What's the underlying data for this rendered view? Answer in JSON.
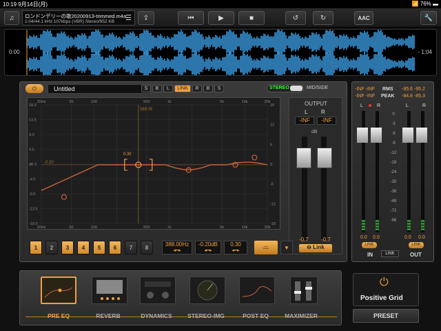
{
  "status": {
    "time": "10:19",
    "date": "9月14日(月)",
    "battery": "76%"
  },
  "file": {
    "name": "ロンドンデリーの歌20200913-trimmed.m4a",
    "meta": "1:04/44.1 kHz 107kbps (VBR) Stereo/952 KB"
  },
  "toolbar": {
    "aac_label": "AAC"
  },
  "waveform": {
    "start": "0:00",
    "end": "- 1:04"
  },
  "eq": {
    "preset": "Untitled",
    "channels": [
      "S",
      "B",
      "L",
      "LINK",
      "R",
      "B",
      "S"
    ],
    "active_channel": "LINK",
    "stereo_label": "STEREO",
    "midside_label": "MID/SIDE",
    "freq_ticks": [
      "20Hz",
      "50",
      "100",
      "500",
      "1k",
      "5k",
      "10k",
      "20k"
    ],
    "db_ticks_left": [
      "18.0",
      "13.5",
      "9.0",
      "4.5",
      "dB 0",
      "-4.5",
      "-9.0",
      "-13.5",
      "-18.0"
    ],
    "db_ticks_right": [
      "18",
      "12",
      "6",
      "0",
      "-6",
      "-12",
      "-18"
    ],
    "marker_freq": "388.05",
    "marker_q": "0.30",
    "marker_gain": "-0.20",
    "bands": [
      {
        "label": "1",
        "on": true
      },
      {
        "label": "2",
        "on": false
      },
      {
        "label": "3",
        "on": true
      },
      {
        "label": "4",
        "on": true
      },
      {
        "label": "5",
        "on": true
      },
      {
        "label": "6",
        "on": true
      },
      {
        "label": "7",
        "on": false
      },
      {
        "label": "8",
        "on": false
      }
    ],
    "freq_value": "388.00Hz",
    "gain_value": "-0.20dB",
    "q_value": "0.30",
    "output_label": "OUTPUT",
    "out_l": "L",
    "out_r": "R",
    "out_l_val": "-INF",
    "out_r_val": "-INF",
    "db_label": "dB",
    "out_l_bottom": "-0.7",
    "out_r_bottom": "-0.7",
    "link_label": "Link"
  },
  "meters": {
    "rms_label": "RMS",
    "peak_label": "PEAK",
    "in_rms": "-INF -INF",
    "in_peak": "-INF -INF",
    "out_rms": "-95.6 -95.2",
    "out_peak": "-84.8 -85.3",
    "scale": [
      "0",
      "-3",
      "-6",
      "-9",
      "-12",
      "-18",
      "-24",
      "-30",
      "-36",
      "-48",
      "-72",
      "-96"
    ],
    "in_l": "L",
    "in_r": "R",
    "out_l": "L",
    "out_r": "R",
    "in_vals": [
      "0.0",
      "0.0"
    ],
    "out_vals": [
      "0.0",
      "0.0"
    ],
    "link": "LINK",
    "in_label": "IN",
    "out_label": "OUT"
  },
  "chain": {
    "modules": [
      "PRE EQ",
      "REVERB",
      "DYNAMICS",
      "STEREO-IMG",
      "POST EQ",
      "MAXIMIZER"
    ],
    "active": "PRE EQ"
  },
  "brand": {
    "name": "Positive Grid",
    "preset": "PRESET"
  },
  "colors": {
    "accent": "#f0a040",
    "wave": "#3fa9f5",
    "green": "#33ff33"
  }
}
